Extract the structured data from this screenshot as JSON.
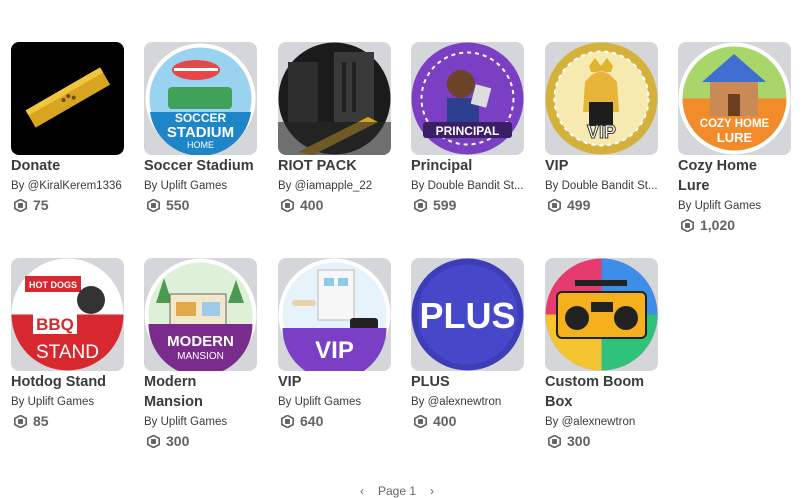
{
  "items": [
    {
      "name": "Donate",
      "by": "By",
      "creator": "@KiralKerem1336",
      "price": "75",
      "icon": "gold-bar-icon"
    },
    {
      "name": "Soccer Stadium",
      "by": "By",
      "creator": "Uplift Games",
      "price": "550",
      "icon": "soccer-stadium-thumbnail"
    },
    {
      "name": "RIOT PACK",
      "by": "By",
      "creator": "@iamapple_22",
      "price": "400",
      "icon": "riot-pack-thumbnail"
    },
    {
      "name": "Principal",
      "by": "By",
      "creator": "Double Bandit St...",
      "price": "599",
      "icon": "principal-thumbnail"
    },
    {
      "name": "VIP",
      "by": "By",
      "creator": "Double Bandit St...",
      "price": "499",
      "icon": "vip-crown-thumbnail"
    },
    {
      "name": "Cozy Home Lure",
      "by": "By",
      "creator": "Uplift Games",
      "price": "1,020",
      "icon": "cozy-home-thumbnail"
    },
    {
      "name": "Hotdog Stand",
      "by": "By",
      "creator": "Uplift Games",
      "price": "85",
      "icon": "hotdog-stand-thumbnail"
    },
    {
      "name": "Modern Mansion",
      "by": "By",
      "creator": "Uplift Games",
      "price": "300",
      "icon": "modern-mansion-thumbnail"
    },
    {
      "name": "VIP",
      "by": "By",
      "creator": "Uplift Games",
      "price": "640",
      "icon": "vip-city-thumbnail"
    },
    {
      "name": "PLUS",
      "by": "By",
      "creator": "@alexnewtron",
      "price": "400",
      "icon": "plus-thumbnail"
    },
    {
      "name": "Custom Boom Box",
      "by": "By",
      "creator": "@alexnewtron",
      "price": "300",
      "icon": "boombox-thumbnail"
    }
  ],
  "thumb_text": {
    "soccer": [
      "SOCCER",
      "STADIUM",
      "HOME"
    ],
    "principal": "PRINCIPAL",
    "vip1": "VIP",
    "cozy": [
      "COZY HOME",
      "LURE"
    ],
    "hotdog": [
      "HOT DOGS",
      "BBQ",
      "STAND"
    ],
    "modern": [
      "MODERN",
      "MANSION"
    ],
    "vip2": "VIP",
    "plus": "PLUS"
  },
  "pager": {
    "prev": "‹",
    "label": "Page 1",
    "next": "›"
  }
}
